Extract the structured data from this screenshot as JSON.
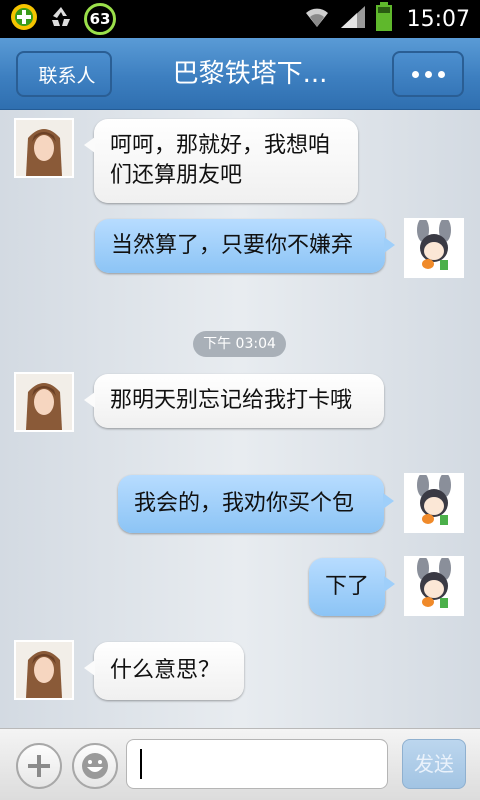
{
  "status_bar": {
    "time": "15:07",
    "badge_count": "63",
    "icons": [
      "plus-badge-icon",
      "recycle-icon",
      "wifi-icon",
      "signal-icon",
      "battery-icon"
    ]
  },
  "header": {
    "back_label": "联系人",
    "title": "巴黎铁塔下...",
    "more_icon": "more-dots-icon"
  },
  "messages": [
    {
      "side": "in",
      "text": "呵呵，那就好，我想咱们还算朋友吧"
    },
    {
      "side": "out",
      "text": "当然算了，只要你不嫌弃"
    },
    {
      "side": "in",
      "text": "那明天别忘记给我打卡哦"
    },
    {
      "side": "out",
      "text": "我会的，我劝你买个包"
    },
    {
      "side": "out",
      "text": "下了"
    },
    {
      "side": "in",
      "text": "什么意思？"
    }
  ],
  "timestamp": "下午 03:04",
  "composer": {
    "value": "",
    "placeholder": "",
    "send_label": "发送",
    "add_icon": "plus-icon",
    "emoji_icon": "smiley-icon"
  },
  "colors": {
    "header": "#3d7fc0",
    "out_bubble": "#9fcffa",
    "in_bubble": "#ffffff"
  }
}
